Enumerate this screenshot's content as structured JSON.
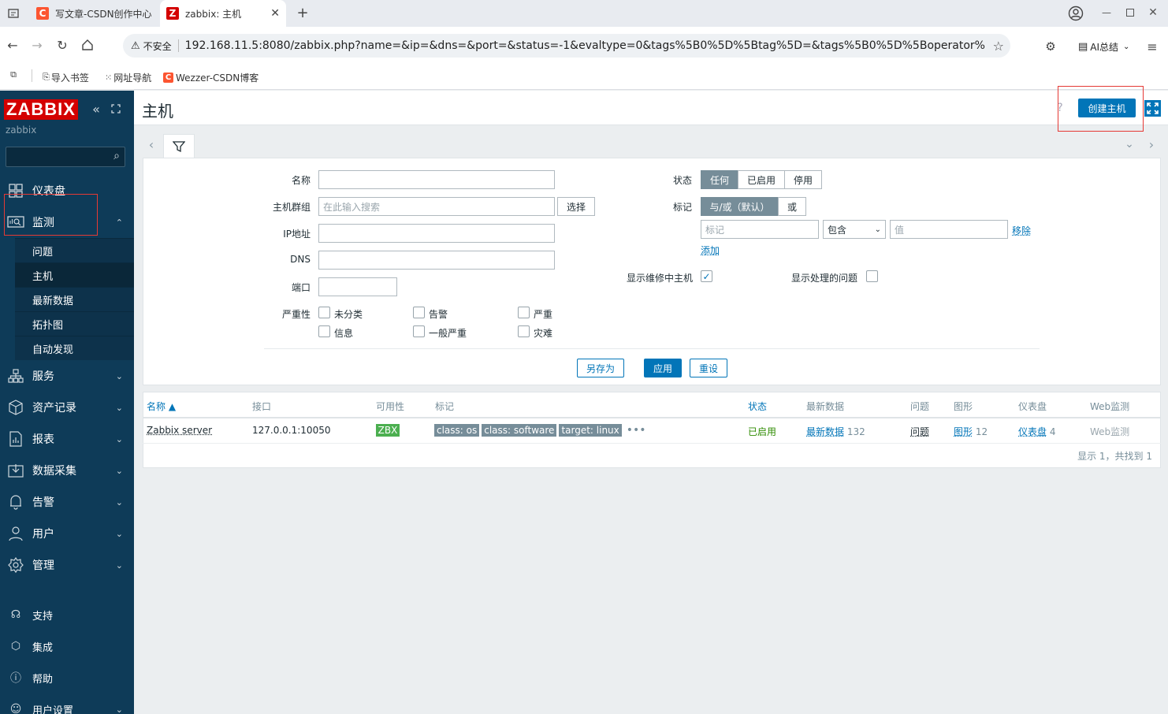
{
  "browser": {
    "tabs": [
      {
        "label": "写文章-CSDN创作中心",
        "favicon": "C",
        "color": "#fc5531"
      },
      {
        "label": "zabbix: 主机",
        "favicon": "Z",
        "color": "#d40000"
      }
    ],
    "url_security": "不安全",
    "url": "192.168.11.5:8080/zabbix.php?name=&ip=&dns=&port=&status=-1&evaltype=0&tags%5B0%5D%5Btag%5D=&tags%5B0%5D%5Boperator%5D=0...",
    "ai_label": "AI总结",
    "bookmarks": [
      "导入书签",
      "网址导航",
      "Wezzer-CSDN博客"
    ]
  },
  "sidebar": {
    "logo": "ZABBIX",
    "server_name": "zabbix",
    "search_placeholder": "",
    "items": [
      {
        "label": "仪表盘",
        "icon": "dashboard-icon"
      },
      {
        "label": "监测",
        "icon": "monitoring-icon"
      },
      {
        "label": "服务",
        "icon": "services-icon"
      },
      {
        "label": "资产记录",
        "icon": "inventory-icon"
      },
      {
        "label": "报表",
        "icon": "reports-icon"
      },
      {
        "label": "数据采集",
        "icon": "data-collection-icon"
      },
      {
        "label": "告警",
        "icon": "alerts-icon"
      },
      {
        "label": "用户",
        "icon": "users-icon"
      },
      {
        "label": "管理",
        "icon": "administration-icon"
      }
    ],
    "sub_items": [
      "问题",
      "主机",
      "最新数据",
      "拓扑图",
      "自动发现"
    ],
    "footer": [
      "支持",
      "集成",
      "帮助",
      "用户设置"
    ]
  },
  "page": {
    "title": "主机",
    "create_button": "创建主机"
  },
  "filter": {
    "name_label": "名称",
    "hostgroup_label": "主机群组",
    "hostgroup_placeholder": "在此输入搜索",
    "select_button": "选择",
    "ip_label": "IP地址",
    "dns_label": "DNS",
    "port_label": "端口",
    "severity_label": "严重性",
    "severities": [
      "未分类",
      "告警",
      "严重",
      "信息",
      "一般严重",
      "灾难"
    ],
    "status_label": "状态",
    "status_options": [
      "任何",
      "已启用",
      "停用"
    ],
    "tags_label": "标记",
    "tag_eval_options": [
      "与/或（默认）",
      "或"
    ],
    "tag_placeholder": "标记",
    "tag_operator": "包含",
    "value_placeholder": "值",
    "remove_link": "移除",
    "add_link": "添加",
    "show_maintenance_label": "显示维修中主机",
    "show_suppressed_label": "显示处理的问题",
    "save_as_button": "另存为",
    "apply_button": "应用",
    "reset_button": "重设"
  },
  "table": {
    "headers": [
      "名称 ▲",
      "接口",
      "可用性",
      "标记",
      "状态",
      "最新数据",
      "问题",
      "图形",
      "仪表盘",
      "Web监测"
    ],
    "rows": [
      {
        "name": "Zabbix server",
        "interface": "127.0.0.1:10050",
        "availability": "ZBX",
        "tags": [
          "class: os",
          "class: software",
          "target: linux"
        ],
        "status": "已启用",
        "latest_data": "最新数据",
        "latest_count": "132",
        "problems": "问题",
        "graphs": "图形",
        "graphs_count": "12",
        "dashboards": "仪表盘",
        "dashboards_count": "4",
        "web": "Web监测"
      }
    ],
    "footer": "显示 1，共找到 1"
  },
  "colors": {
    "sidebar": "#0e3b58",
    "accent": "#0275b8",
    "status_enabled": "#2e8b00",
    "zbx_green": "#4caf50"
  }
}
